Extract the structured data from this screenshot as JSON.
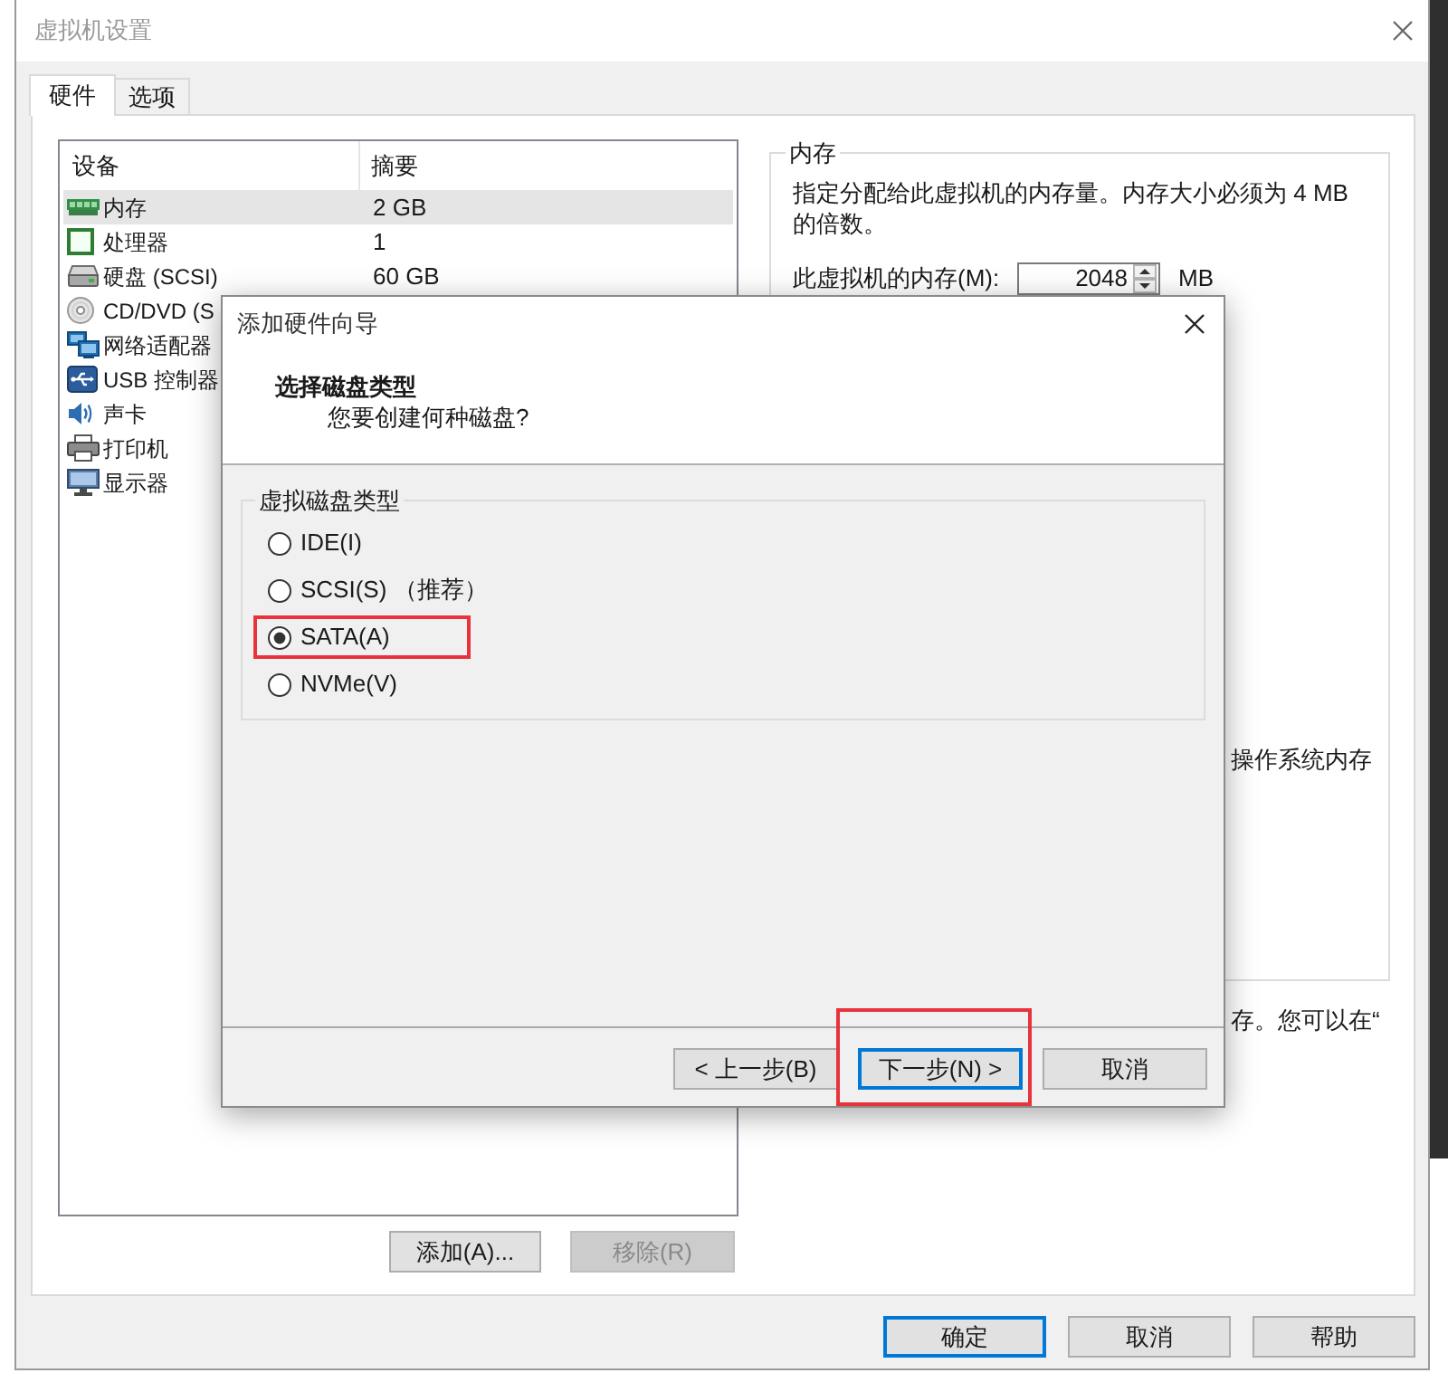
{
  "window": {
    "title": "虚拟机设置"
  },
  "tabs": [
    {
      "label": "硬件",
      "selected": true
    },
    {
      "label": "选项",
      "selected": false
    }
  ],
  "device_list": {
    "columns": [
      "设备",
      "摘要"
    ],
    "rows": [
      {
        "kind": "memory",
        "device": "内存",
        "summary": "2 GB",
        "selected": true
      },
      {
        "kind": "processor",
        "device": "处理器",
        "summary": "1",
        "selected": false
      },
      {
        "kind": "hard_disk",
        "device": "硬盘 (SCSI)",
        "summary": "60 GB",
        "selected": false
      },
      {
        "kind": "cd_dvd",
        "device": "CD/DVD (S",
        "selected": false
      },
      {
        "kind": "network",
        "device": "网络适配器",
        "selected": false
      },
      {
        "kind": "usb",
        "device": "USB 控制器",
        "selected": false
      },
      {
        "kind": "sound",
        "device": "声卡",
        "selected": false
      },
      {
        "kind": "printer",
        "device": "打印机",
        "selected": false
      },
      {
        "kind": "display",
        "device": "显示器",
        "selected": false
      }
    ]
  },
  "memory_panel": {
    "title": "内存",
    "description": "指定分配给此虚拟机的内存量。内存大小必须为 4 MB 的倍数。",
    "field_label": "此虚拟机的内存(M):",
    "value": "2048",
    "unit": "MB",
    "partial_lines": [
      "操作系统内存",
      "存。您可以在“"
    ]
  },
  "dialog": {
    "title": "添加硬件向导",
    "heading": "选择磁盘类型",
    "subheading": "您要创建何种磁盘?",
    "group_title": "虚拟磁盘类型",
    "options": [
      {
        "label": "IDE(I)",
        "selected": false,
        "highlighted": false
      },
      {
        "label": "SCSI(S) （推荐）",
        "selected": false,
        "highlighted": false
      },
      {
        "label": "SATA(A)",
        "selected": true,
        "highlighted": true
      },
      {
        "label": "NVMe(V)",
        "selected": false,
        "highlighted": false
      }
    ],
    "buttons": [
      {
        "label": "< 上一步(B)",
        "focused": false,
        "highlighted": false
      },
      {
        "label": "下一步(N) >",
        "focused": true,
        "highlighted": true
      },
      {
        "label": "取消",
        "focused": false,
        "highlighted": false
      }
    ]
  },
  "list_buttons": [
    {
      "label": "添加(A)...",
      "disabled": false
    },
    {
      "label": "移除(R)",
      "disabled": true
    }
  ],
  "footer_buttons": [
    {
      "label": "确定",
      "focused": true
    },
    {
      "label": "取消",
      "focused": false
    },
    {
      "label": "帮助",
      "focused": false
    }
  ]
}
